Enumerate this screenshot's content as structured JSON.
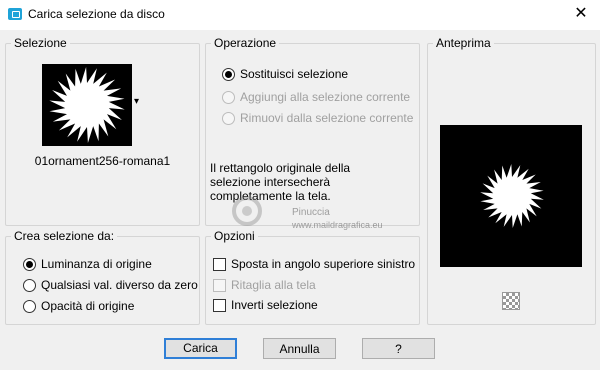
{
  "window": {
    "title": "Carica selezione da disco",
    "close_glyph": "✕",
    "app_icon": "psp-app-icon"
  },
  "selezione": {
    "legend": "Selezione",
    "filename": "01ornament256-romana1",
    "dropdown_glyph": "▾"
  },
  "operazione": {
    "legend": "Operazione",
    "options": [
      {
        "label": "Sostituisci selezione",
        "checked": true,
        "enabled": true
      },
      {
        "label": "Aggiungi alla selezione corrente",
        "checked": false,
        "enabled": false
      },
      {
        "label": "Rimuovi dalla selezione corrente",
        "checked": false,
        "enabled": false
      }
    ],
    "info_lines": [
      "Il rettangolo originale della",
      "selezione intersecherà",
      "completamente la tela."
    ]
  },
  "anteprima": {
    "legend": "Anteprima",
    "zoom_icon": "checkerboard-icon"
  },
  "crea": {
    "legend": "Crea selezione da:",
    "options": [
      {
        "label": "Luminanza di origine",
        "checked": true
      },
      {
        "label": "Qualsiasi val. diverso da zero",
        "checked": false
      },
      {
        "label": "Opacità di origine",
        "checked": false
      }
    ]
  },
  "opzioni": {
    "legend": "Opzioni",
    "options": [
      {
        "label": "Sposta in angolo superiore sinistro",
        "checked": false,
        "enabled": true
      },
      {
        "label": "Ritaglia alla tela",
        "checked": false,
        "enabled": false
      },
      {
        "label": "Inverti selezione",
        "checked": false,
        "enabled": true
      }
    ]
  },
  "watermark": {
    "line1": "Pinuccia",
    "line2": "www.maildragrafica.eu"
  },
  "buttons": {
    "load": "Carica",
    "cancel": "Annulla",
    "help": "?"
  }
}
